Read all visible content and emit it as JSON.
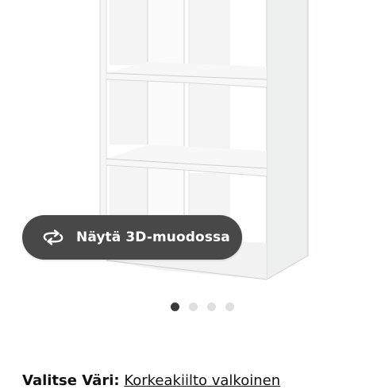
{
  "view_3d": {
    "label": "Näytä 3D-muodossa",
    "icon": "rotate-3d-icon"
  },
  "carousel": {
    "count": 4,
    "active": 0
  },
  "selection": {
    "label": "Valitse Väri:",
    "value": "Korkeakiilto valkoinen"
  },
  "colors": {
    "button_bg": "#484848",
    "dot_active": "#3a3a3a",
    "dot_inactive": "#dfdfdf"
  }
}
